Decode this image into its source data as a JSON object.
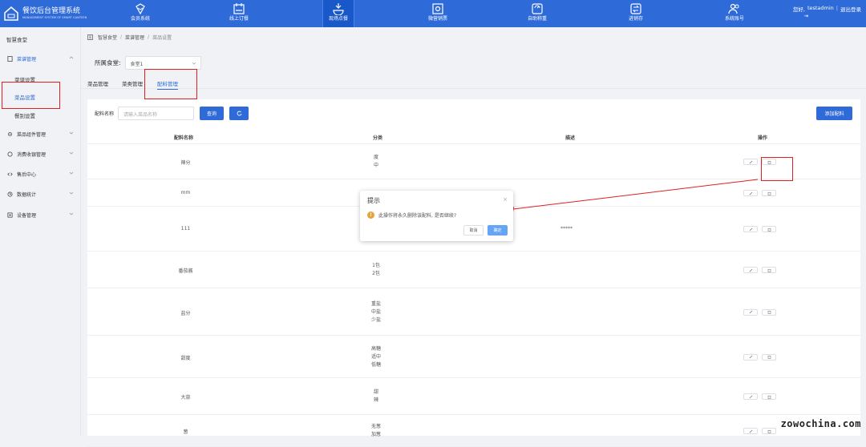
{
  "app": {
    "title": "餐饮后台管理系统",
    "subtitle": "MANAGEMENT SYSTEM OF SMART CANTEEN"
  },
  "nav": [
    "会员系统",
    "线上订餐",
    "现场点餐",
    "微营销票",
    "自助称重",
    "进销存",
    "系统账号"
  ],
  "user": {
    "greeting": "您好,",
    "name": "testadmin",
    "logout": "退出登录"
  },
  "sidebar": {
    "title": "智慧食堂",
    "menus": [
      "菜谱管理",
      "菜品组件管理",
      "消费收银管理",
      "售后中心",
      "数据统计",
      "设备管理"
    ],
    "subitems": [
      "菜谱设置",
      "菜品设置",
      "餐别设置"
    ]
  },
  "breadcrumb": [
    "智慧食堂",
    "菜谱管理",
    "菜品设置"
  ],
  "canteen": {
    "label": "所属食堂:",
    "value": "食堂1"
  },
  "tabs": [
    "菜品管理",
    "菜类管理",
    "配料管理"
  ],
  "search": {
    "label": "配料名称",
    "placeholder": "请输入菜品名称",
    "query": "查询",
    "add": "添加配料"
  },
  "table": {
    "headers": [
      "配料名称",
      "分类",
      "描述",
      "操作"
    ],
    "rows": [
      {
        "name": "辣分",
        "cats": [
          "度",
          "中"
        ],
        "desc": ""
      },
      {
        "name": "mm",
        "cats": [],
        "desc": ""
      },
      {
        "name": "111",
        "cats": [],
        "desc": "*****"
      },
      {
        "name": "番茄酱",
        "cats": [
          "1包",
          "2包"
        ],
        "desc": ""
      },
      {
        "name": "盐分",
        "cats": [
          "重盐",
          "中盐",
          "少盐"
        ],
        "desc": ""
      },
      {
        "name": "甜度",
        "cats": [
          "高糖",
          "适中",
          "低糖"
        ],
        "desc": ""
      },
      {
        "name": "大蒜",
        "cats": [
          "甜",
          "辣"
        ],
        "desc": ""
      },
      {
        "name": "葱",
        "cats": [
          "无葱",
          "加葱"
        ],
        "desc": ""
      }
    ]
  },
  "dialog": {
    "title": "提示",
    "close": "×",
    "message": "此操作将永久删除该配料, 是否继续?",
    "cancel": "取消",
    "confirm": "确定",
    "warn": "!"
  },
  "watermark": "zowochina.com",
  "colors": {
    "primary": "#2f6bd8",
    "annotation": "#e02020",
    "warning": "#e6a23c"
  }
}
